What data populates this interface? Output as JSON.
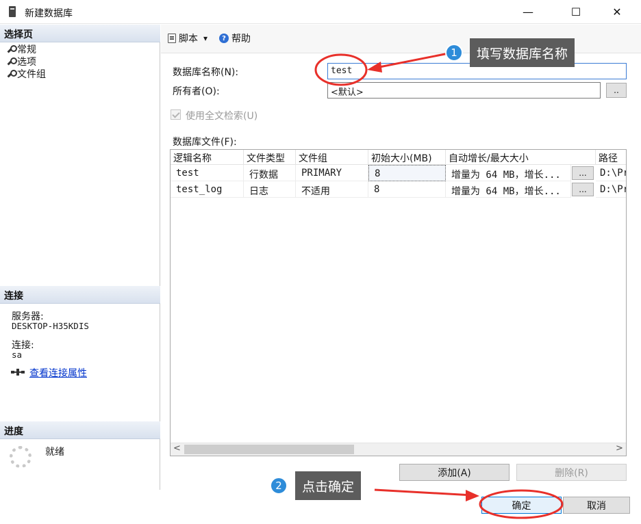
{
  "window": {
    "title": "新建数据库",
    "minimize": "—",
    "maximize": "☐",
    "close": "✕"
  },
  "left": {
    "select_page_header": "选择页",
    "pages": [
      "常规",
      "选项",
      "文件组"
    ],
    "connection_header": "连接",
    "server_label": "服务器:",
    "server_value": "DESKTOP-H35KDIS",
    "connection_label": "连接:",
    "connection_value": "sa",
    "view_conn_props": "查看连接属性",
    "progress_header": "进度",
    "progress_status": "就绪"
  },
  "toolbar": {
    "script_label": "脚本",
    "dropdown_glyph": "▾",
    "help_label": "帮助",
    "help_glyph": "?"
  },
  "form": {
    "db_name_label": "数据库名称(N):",
    "db_name_value": "test",
    "owner_label": "所有者(O):",
    "owner_value": "<默认>",
    "owner_browse": "..",
    "fulltext_label": "使用全文检索(U)",
    "db_files_label": "数据库文件(F):"
  },
  "grid": {
    "columns": [
      "逻辑名称",
      "文件类型",
      "文件组",
      "初始大小(MB)",
      "自动增长/最大大小",
      "路径"
    ],
    "rows": [
      {
        "name": "test",
        "type": "行数据",
        "filegroup": "PRIMARY",
        "size": "8",
        "growth": "增量为 64 MB，增长...",
        "browse": "...",
        "path": "D:\\Pr"
      },
      {
        "name": "test_log",
        "type": "日志",
        "filegroup": "不适用",
        "size": "8",
        "growth": "增量为 64 MB，增长...",
        "browse": "...",
        "path": "D:\\Pr"
      }
    ],
    "scroll_left": "<",
    "scroll_right": ">"
  },
  "buttons": {
    "add": "添加(A)",
    "remove": "删除(R)",
    "ok": "确定",
    "cancel": "取消"
  },
  "annotations": [
    {
      "number": "1",
      "text": "填写数据库名称"
    },
    {
      "number": "2",
      "text": "点击确定"
    }
  ],
  "colors": {
    "annotation_red": "#e8302a",
    "callout_blue": "#2e8cd9",
    "callout_bg": "#5c5c5c",
    "header_grad": "#d8e1ee",
    "link": "#0033cc"
  }
}
